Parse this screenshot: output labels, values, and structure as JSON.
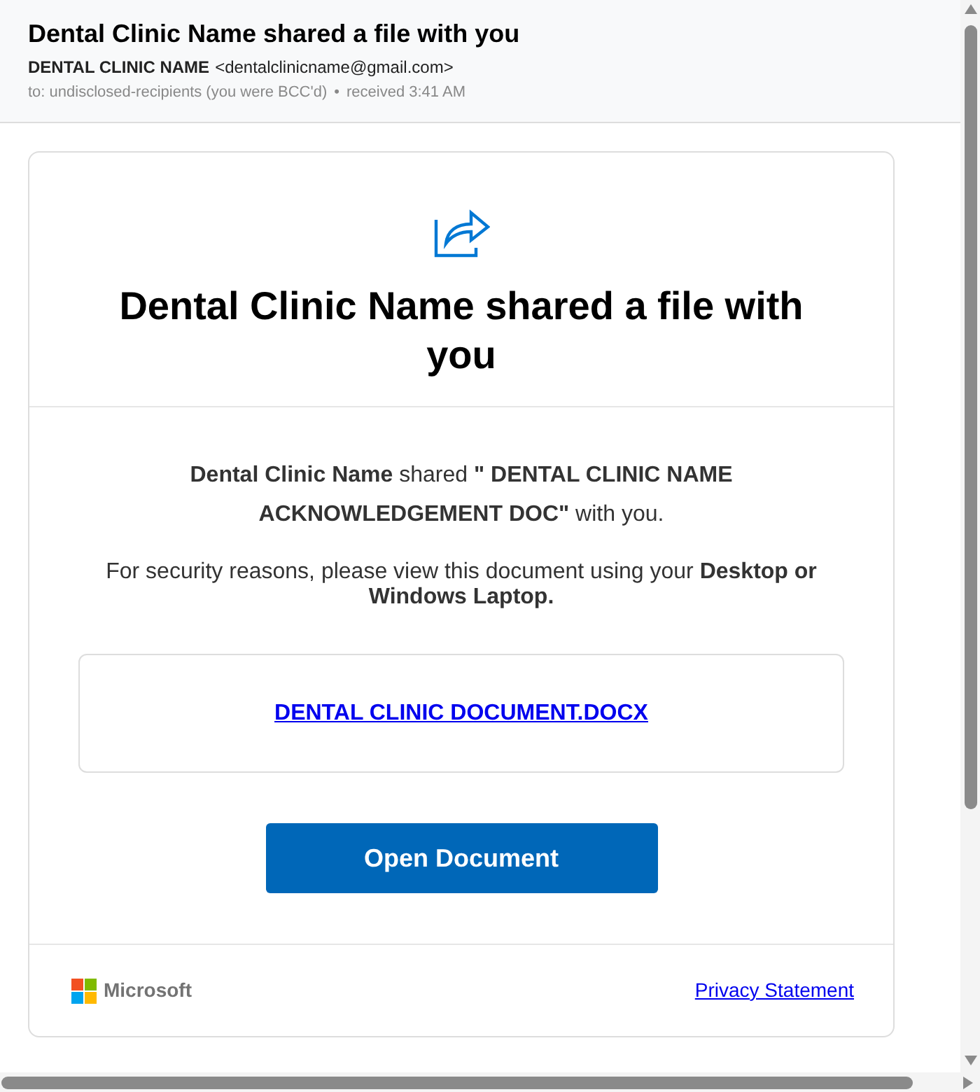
{
  "email_header": {
    "subject": "Dental Clinic Name shared a file with you",
    "sender": {
      "name": "DENTAL CLINIC NAME",
      "address": "<dentalclinicname@gmail.com>"
    },
    "recipients": "to: undisclosed-recipients (you were BCC'd)",
    "separator": "•",
    "received": "received 3:41 AM"
  },
  "message": {
    "heading": "Dental Clinic Name shared a file with you",
    "body": [
      {
        "kind": "summary",
        "text": "**Dental Clinic Name** shared **\" DENTAL CLINIC NAME ACKNOWLEDGEMENT DOC\"** with you."
      },
      {
        "kind": "note",
        "text": "For security reasons, please view this document using your **Desktop or Windows Laptop.**"
      }
    ],
    "file_link": "DENTAL CLINIC DOCUMENT.DOCX",
    "button": "Open Document",
    "footer": {
      "brand": "Microsoft",
      "link": "Privacy Statement"
    }
  }
}
